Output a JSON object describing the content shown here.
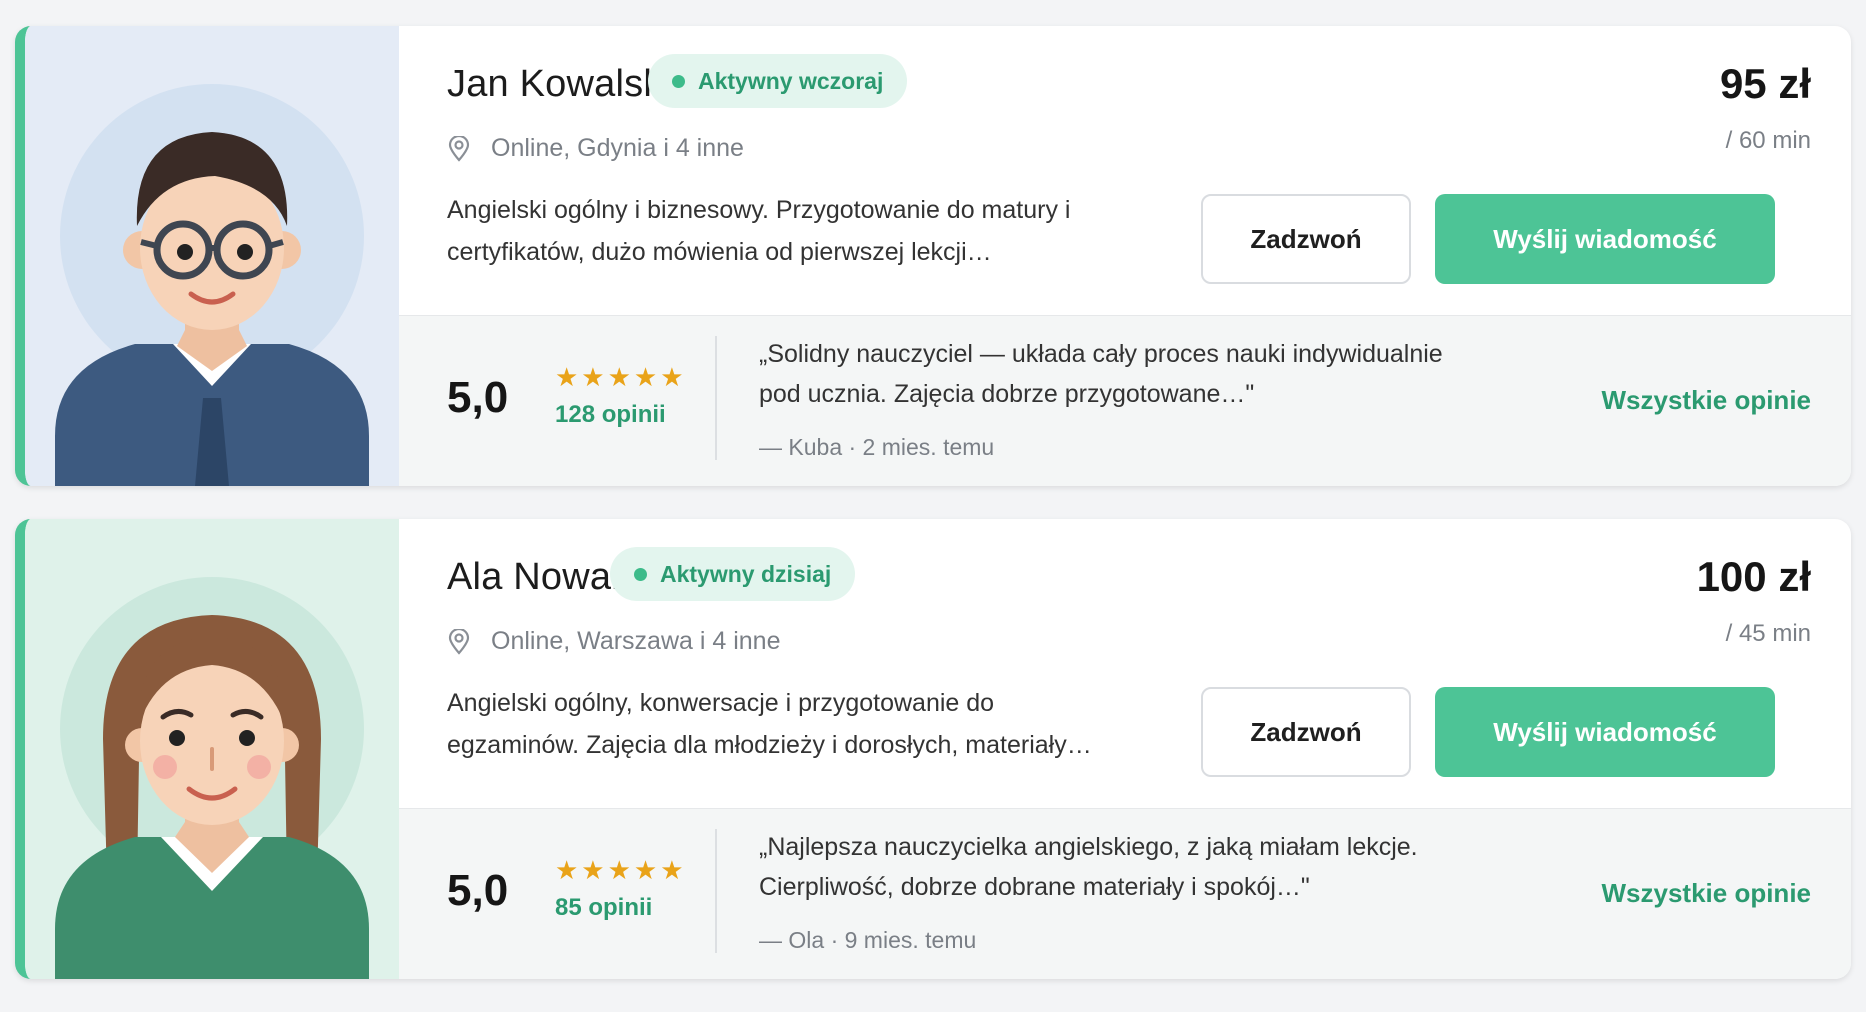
{
  "colors": {
    "accent": "#4dc496",
    "accent_text": "#2b9a70",
    "badge_bg": "#e3f5ee",
    "star": "#e9a319",
    "muted": "#7a7f86"
  },
  "tutors": [
    {
      "name": "Jan Kowalski",
      "status": "Aktywny wczoraj",
      "location": "Online, Gdynia i 4 inne",
      "description_line1": "Angielski ogólny i biznesowy. Przygotowanie do matury i",
      "description_line2": "certyfikatów, dużo mówienia od pierwszej lekcji…",
      "price": "95 zł",
      "per": "/ 60 min",
      "call_label": "Zadzwoń",
      "message_label": "Wyślij wiadomość",
      "rating": "5,0",
      "stars": "★★★★★",
      "rating_value": 5,
      "reviews_label": "128 opinii",
      "quote_line1": "„Solidny nauczyciel — układa cały proces nauki indywidualnie",
      "quote_line2": "pod ucznia. Zajęcia dobrze przygotowane…\"",
      "quote_author": "— Kuba · 2 mies. temu",
      "all_reviews_label": "Wszystkie opinie",
      "avatar_icon": "male-tutor-avatar-icon"
    },
    {
      "name": "Ala Nowak",
      "status": "Aktywny dzisiaj",
      "location": "Online, Warszawa i 4 inne",
      "description_line1": "Angielski ogólny, konwersacje i przygotowanie do",
      "description_line2": "egzaminów. Zajęcia dla młodzieży i dorosłych, materiały…",
      "price": "100 zł",
      "per": "/ 45 min",
      "call_label": "Zadzwoń",
      "message_label": "Wyślij wiadomość",
      "rating": "5,0",
      "stars": "★★★★★",
      "rating_value": 5,
      "reviews_label": "85 opinii",
      "quote_line1": "„Najlepsza nauczycielka angielskiego, z jaką miałam lekcje.",
      "quote_line2": "Cierpliwość, dobrze dobrane materiały i spokój…\"",
      "quote_author": "— Ola · 9 mies. temu",
      "all_reviews_label": "Wszystkie opinie",
      "avatar_icon": "female-tutor-avatar-icon"
    }
  ]
}
